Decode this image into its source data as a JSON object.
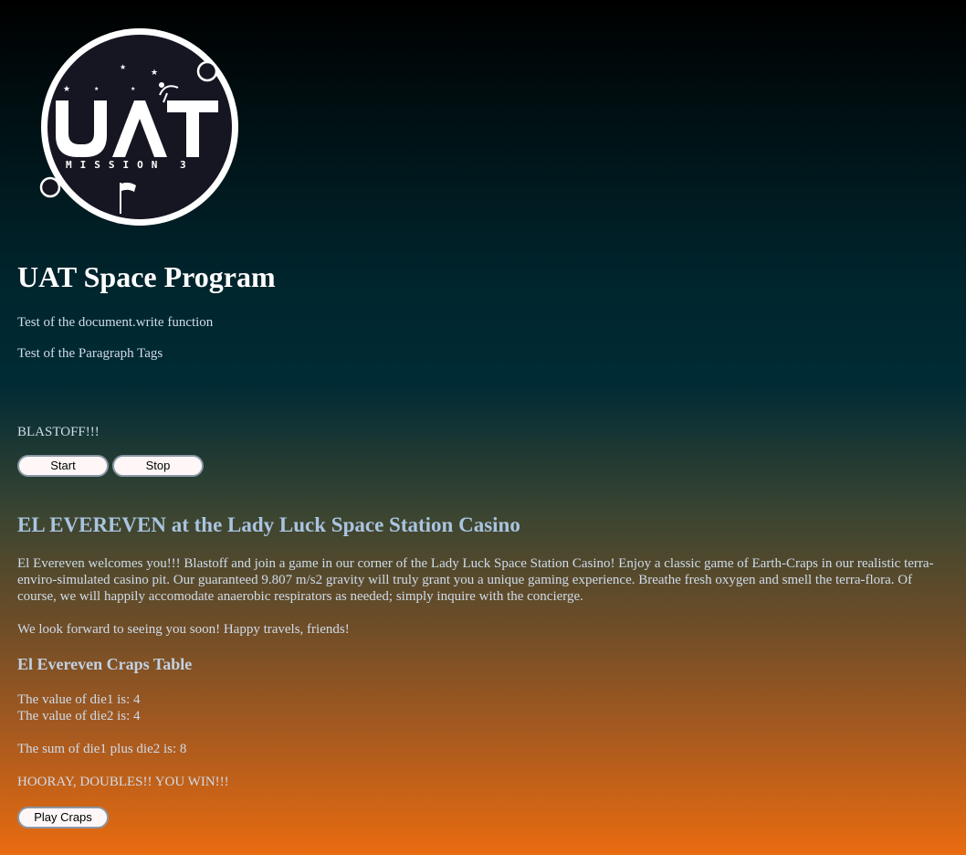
{
  "logo": {
    "main_text": "UAT",
    "sub_text": "MISSION 3"
  },
  "header": {
    "title": "UAT Space Program"
  },
  "intro": {
    "line1": "Test of the document.write function",
    "line2": "Test of the Paragraph Tags",
    "blastoff": "BLASTOFF!!!"
  },
  "controls": {
    "start_label": "Start",
    "stop_label": "Stop"
  },
  "casino": {
    "heading": "EL EVEREVEN at the Lady Luck Space Station Casino",
    "welcome": "El Evereven welcomes you!!! Blastoff and join a game in our corner of the Lady Luck Space Station Casino! Enjoy a classic game of Earth-Craps in our realistic terra-enviro-simulated casino pit. Our guaranteed 9.807 m/s2 gravity will truly grant you a unique gaming experience. Breathe fresh oxygen and smell the terra-flora. Of course, we will happily accomodate anaerobic respirators as needed; simply inquire with the concierge.",
    "farewell": "We look forward to seeing you soon! Happy travels, friends!"
  },
  "craps": {
    "heading": "El Evereven Craps Table",
    "die1": "The value of die1 is: 4",
    "die2": "The value of die2 is: 4",
    "sum": "The sum of die1 plus die2 is: 8",
    "result": "HOORAY, DOUBLES!! YOU WIN!!!",
    "play_label": "Play Craps"
  }
}
